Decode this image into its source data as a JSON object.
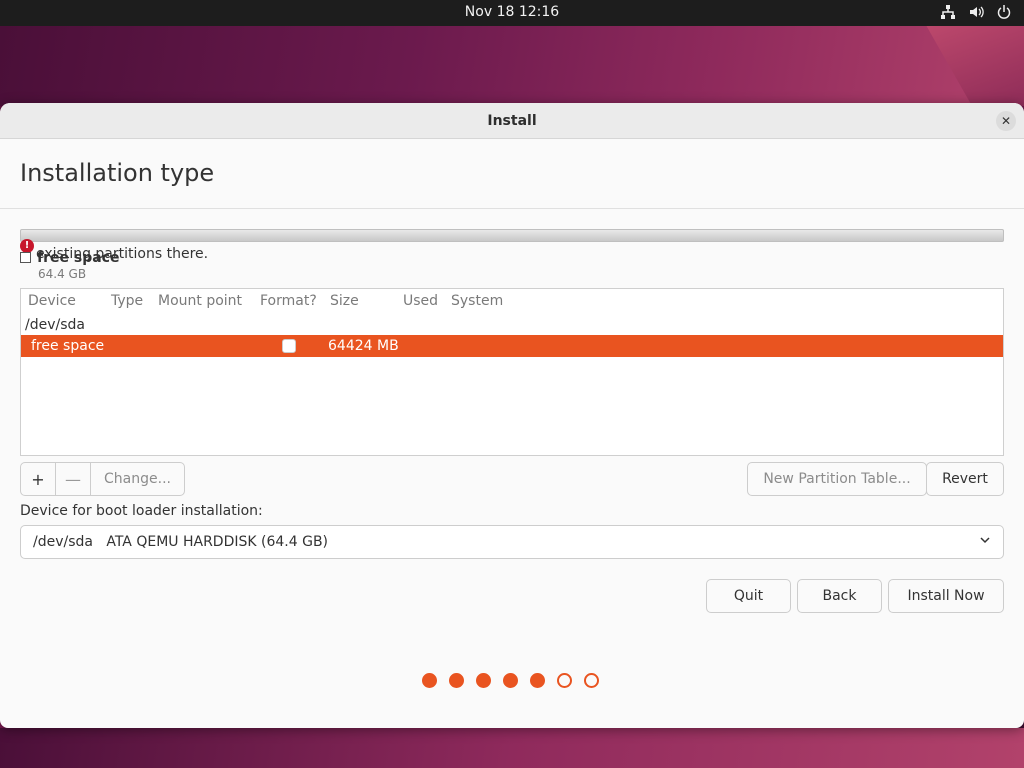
{
  "topbar": {
    "clock": "Nov 18  12:16"
  },
  "window": {
    "title": "Install",
    "close_label": "✕"
  },
  "header": {
    "title": "Installation type"
  },
  "partition_bar": {
    "warning_text": "existing partitions there.",
    "legend_label": "free space",
    "legend_size": "64.4 GB"
  },
  "table": {
    "columns": [
      "Device",
      "Type",
      "Mount point",
      "Format?",
      "Size",
      "Used",
      "System"
    ],
    "device_row": "/dev/sda",
    "selected_row": {
      "device": "free space",
      "size": "64424 MB"
    }
  },
  "buttons": {
    "add": "+",
    "remove": "—",
    "change": "Change...",
    "new_table": "New Partition Table...",
    "revert": "Revert",
    "quit": "Quit",
    "back": "Back",
    "install": "Install Now"
  },
  "boot_loader": {
    "label": "Device for boot loader installation:",
    "device": "/dev/sda",
    "description": "ATA QEMU HARDDISK (64.4 GB)"
  },
  "progress": {
    "total_steps": 7,
    "completed_steps": 5
  },
  "colors": {
    "accent": "#e95420",
    "topbar": "#1d1d1d",
    "window_bg": "#fafafa"
  },
  "icons": {
    "tray": [
      "network-icon",
      "volume-icon",
      "power-icon"
    ],
    "dropdown": "chevron-down-icon",
    "warning": "warning-icon"
  }
}
